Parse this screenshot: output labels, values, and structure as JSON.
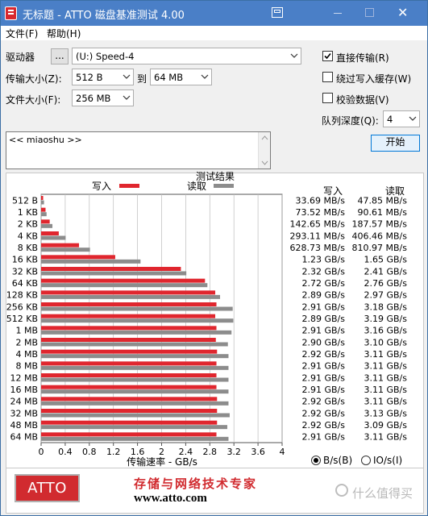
{
  "window": {
    "title": "无标题 - ATTO 磁盘基准测试 4.00",
    "close_glyph": "✕"
  },
  "menu": {
    "items": [
      "文件(F)",
      "帮助(H)"
    ]
  },
  "controls": {
    "drive_label": "驱动器",
    "browse_label": "...",
    "drive_value": "(U:) Speed-4",
    "transfer_label": "传输大小(Z):",
    "transfer_from": "512 B",
    "to_label": "到",
    "transfer_to": "64 MB",
    "filesize_label": "文件大小(F):",
    "filesize_value": "256 MB",
    "direct_io_label": "直接传输(R)",
    "direct_io_checked": true,
    "bypass_cache_label": "绕过写入缓存(W)",
    "bypass_cache_checked": false,
    "verify_label": "校验数据(V)",
    "verify_checked": false,
    "queue_label": "队列深度(Q):",
    "queue_value": "4",
    "start_label": "开始",
    "description": "<< miaoshu >>"
  },
  "results": {
    "heading": "测试结果",
    "write_header": "写入",
    "read_header": "读取",
    "legend_write": "写入",
    "legend_read": "读取",
    "write_color": "#e0262e",
    "read_color": "#8c8c8c"
  },
  "chart_data": {
    "type": "bar",
    "orientation": "horizontal",
    "categories": [
      "512 B",
      "1 KB",
      "2 KB",
      "4 KB",
      "8 KB",
      "16 KB",
      "32 KB",
      "64 KB",
      "128 KB",
      "256 KB",
      "512 KB",
      "1 MB",
      "2 MB",
      "4 MB",
      "8 MB",
      "12 MB",
      "16 MB",
      "24 MB",
      "32 MB",
      "48 MB",
      "64 MB"
    ],
    "series": [
      {
        "name": "写入",
        "values": [
          0.0337,
          0.0735,
          0.1427,
          0.2931,
          0.6288,
          1.23,
          2.32,
          2.72,
          2.89,
          2.91,
          2.89,
          2.91,
          2.9,
          2.92,
          2.91,
          2.91,
          2.91,
          2.92,
          2.92,
          2.92,
          2.91
        ]
      },
      {
        "name": "读取",
        "values": [
          0.0479,
          0.0906,
          0.1876,
          0.4065,
          0.811,
          1.65,
          2.41,
          2.76,
          2.97,
          3.18,
          3.19,
          3.16,
          3.1,
          3.11,
          3.11,
          3.11,
          3.11,
          3.11,
          3.13,
          3.09,
          3.11
        ]
      }
    ],
    "write_labels": [
      "33.69 MB/s",
      "73.52 MB/s",
      "142.65 MB/s",
      "293.11 MB/s",
      "628.73 MB/s",
      "1.23 GB/s",
      "2.32 GB/s",
      "2.72 GB/s",
      "2.89 GB/s",
      "2.91 GB/s",
      "2.89 GB/s",
      "2.91 GB/s",
      "2.90 GB/s",
      "2.92 GB/s",
      "2.91 GB/s",
      "2.91 GB/s",
      "2.91 GB/s",
      "2.92 GB/s",
      "2.92 GB/s",
      "2.92 GB/s",
      "2.91 GB/s"
    ],
    "read_labels": [
      "47.85 MB/s",
      "90.61 MB/s",
      "187.57 MB/s",
      "406.46 MB/s",
      "810.97 MB/s",
      "1.65 GB/s",
      "2.41 GB/s",
      "2.76 GB/s",
      "2.97 GB/s",
      "3.18 GB/s",
      "3.19 GB/s",
      "3.16 GB/s",
      "3.10 GB/s",
      "3.11 GB/s",
      "3.11 GB/s",
      "3.11 GB/s",
      "3.11 GB/s",
      "3.11 GB/s",
      "3.13 GB/s",
      "3.09 GB/s",
      "3.11 GB/s"
    ],
    "x_ticks": [
      "0",
      "0.4",
      "0.8",
      "1.2",
      "1.6",
      "2",
      "2.4",
      "2.8",
      "3.2",
      "3.6",
      "4"
    ],
    "xlabel": "传输速率 - GB/s",
    "xlim": [
      0,
      4
    ],
    "grid": true
  },
  "units": {
    "bs_label": "B/s(B)",
    "bs_selected": true,
    "ios_label": "IO/s(I)",
    "ios_selected": false
  },
  "footer": {
    "logo_text": "ATTO",
    "slogan": "存储与网络技术专家",
    "url": "www.atto.com"
  },
  "watermark": "什么值得买"
}
